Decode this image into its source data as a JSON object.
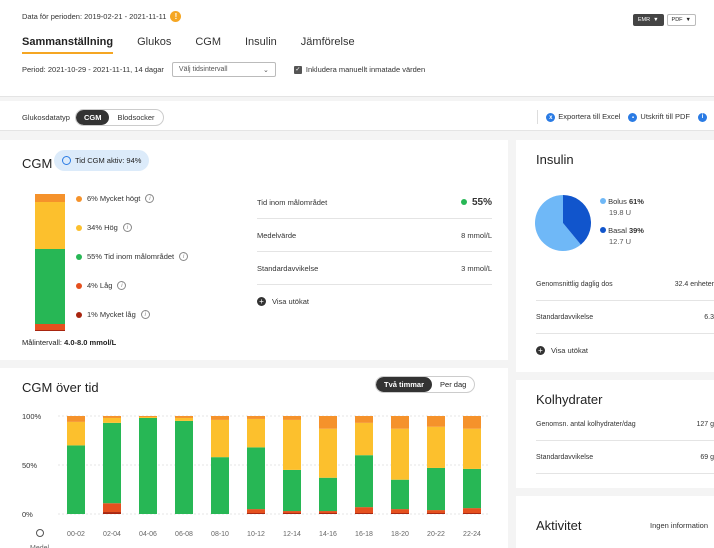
{
  "header": {
    "period_text": "Data för perioden: 2019-02-21 - 2021-11-11",
    "info_icon": "!",
    "export_selects": [
      "EMR",
      "PDF"
    ],
    "tabs": [
      "Sammanställning",
      "Glukos",
      "CGM",
      "Insulin",
      "Jämförelse"
    ],
    "active_tab": "Sammanställning",
    "period_label": "Period: 2021-10-29 - 2021-11-11, 14 dagar",
    "interval_select": "Välj tidsintervall",
    "manual_checkbox_label": "Inkludera manuellt inmatade värden"
  },
  "toolbar": {
    "data_type_label": "Glukosdatatyp",
    "data_type_options": [
      "CGM",
      "Blodsocker"
    ],
    "export_excel": "Exportera till Excel",
    "print_pdf": "Utskrift till PDF"
  },
  "cgm": {
    "title": "CGM",
    "active_pill": "Tid CGM aktiv: 94%",
    "distribution": [
      {
        "label": "6% Mycket högt",
        "percent": 6,
        "color": "#f5922b"
      },
      {
        "label": "34% Hög",
        "percent": 34,
        "color": "#fcc02d"
      },
      {
        "label": "55% Tid inom målområdet",
        "percent": 55,
        "color": "#27b755"
      },
      {
        "label": "4% Låg",
        "percent": 4,
        "color": "#e5501e"
      },
      {
        "label": "1% Mycket låg",
        "percent": 1,
        "color": "#a8250f"
      }
    ],
    "target_label": "Målintervall:",
    "target_value": "4.0-8.0 mmol/L",
    "stats": [
      {
        "label": "Tid inom målområdet",
        "value": "55%"
      },
      {
        "label": "Medelvärde",
        "value": "8 mmol/L"
      },
      {
        "label": "Standardavvikelse",
        "value": "3 mmol/L"
      }
    ],
    "expand_label": "Visa utökat"
  },
  "over_time": {
    "title": "CGM över tid",
    "view_options": [
      "Två timmar",
      "Per dag"
    ],
    "y_ticks": [
      "100%",
      "50%",
      "0%"
    ],
    "row_label_next": "Medel",
    "chart_data": {
      "type": "bar",
      "stacked": true,
      "ylim": [
        0,
        100
      ],
      "categories": [
        "00-02",
        "02-04",
        "04-06",
        "06-08",
        "08-10",
        "10-12",
        "12-14",
        "14-16",
        "16-18",
        "18-20",
        "20-22",
        "22-24"
      ],
      "series": [
        {
          "color": "#a8250f",
          "values": [
            0,
            2,
            0,
            0,
            0,
            1,
            1,
            1,
            1,
            1,
            1,
            1
          ]
        },
        {
          "color": "#e5501e",
          "values": [
            0,
            9,
            0,
            0,
            0,
            4,
            2,
            2,
            6,
            4,
            3,
            5
          ]
        },
        {
          "color": "#27b755",
          "values": [
            70,
            82,
            98,
            95,
            58,
            63,
            42,
            34,
            53,
            30,
            43,
            40
          ]
        },
        {
          "color": "#fcc02d",
          "values": [
            24,
            5,
            1,
            3,
            38,
            29,
            51,
            50,
            33,
            52,
            42,
            41
          ]
        },
        {
          "color": "#f5922b",
          "values": [
            6,
            2,
            1,
            2,
            4,
            3,
            4,
            13,
            7,
            13,
            11,
            13
          ]
        }
      ]
    }
  },
  "insulin": {
    "title": "Insulin",
    "chart_data": {
      "type": "pie",
      "categories": [
        "Bolus",
        "Basal"
      ],
      "values": [
        61,
        39
      ],
      "colors": [
        "#6fb8f7",
        "#1155cc"
      ]
    },
    "bolus_label": "Bolus",
    "bolus_pct": "61%",
    "bolus_units": "19.8 U",
    "basal_label": "Basal",
    "basal_pct": "39%",
    "basal_units": "12.7 U",
    "rows": [
      {
        "label": "Genomsnittlig daglig dos",
        "value": "32.4 enheter"
      },
      {
        "label": "Standardavvikelse",
        "value": "6.3"
      }
    ],
    "expand_label": "Visa utökat"
  },
  "kolhydrater": {
    "title": "Kolhydrater",
    "rows": [
      {
        "label": "Genomsn. antal kolhydrater/dag",
        "value": "127 g"
      },
      {
        "label": "Standardavvikelse",
        "value": "69 g"
      }
    ]
  },
  "aktivitet": {
    "title": "Aktivitet",
    "info": "Ingen information"
  }
}
